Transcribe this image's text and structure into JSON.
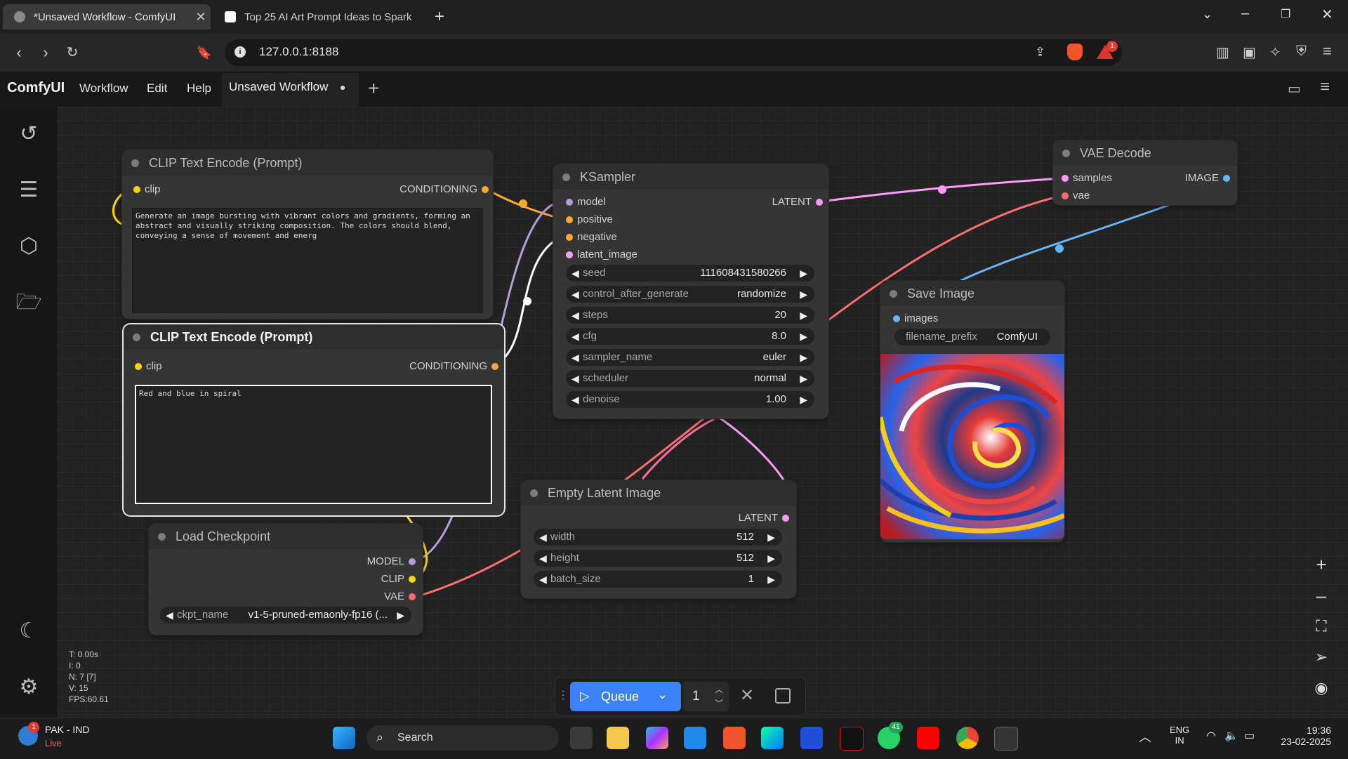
{
  "browser": {
    "tabs": [
      {
        "title": "*Unsaved Workflow - ComfyUI",
        "active": true
      },
      {
        "title": "Top 25 AI Art Prompt Ideas to Spark",
        "active": false
      }
    ],
    "url": "127.0.0.1:8188",
    "notification_count": "1"
  },
  "app": {
    "logo": "ComfyUI",
    "menu": [
      "Workflow",
      "Edit",
      "Help"
    ],
    "workflow_tab": "Unsaved Workflow",
    "unsaved_marker": "●"
  },
  "sidebar_icons": [
    "history-icon",
    "document-icon",
    "cube-icon",
    "folder-icon",
    "moon-icon",
    "gear-icon"
  ],
  "nodes": {
    "clip1": {
      "title": "CLIP Text Encode (Prompt)",
      "input": "clip",
      "output": "CONDITIONING",
      "text": "Generate an image bursting with vibrant colors and gradients, forming an abstract and visually striking composition. The colors should blend, conveying a sense of movement and energ"
    },
    "clip2": {
      "title": "CLIP Text Encode (Prompt)",
      "input": "clip",
      "output": "CONDITIONING",
      "text": "Red and blue in spiral"
    },
    "ksampler": {
      "title": "KSampler",
      "inputs": [
        "model",
        "positive",
        "negative",
        "latent_image"
      ],
      "output": "LATENT",
      "widgets": [
        {
          "label": "seed",
          "value": "111608431580266"
        },
        {
          "label": "control_after_generate",
          "value": "randomize"
        },
        {
          "label": "steps",
          "value": "20"
        },
        {
          "label": "cfg",
          "value": "8.0"
        },
        {
          "label": "sampler_name",
          "value": "euler"
        },
        {
          "label": "scheduler",
          "value": "normal"
        },
        {
          "label": "denoise",
          "value": "1.00"
        }
      ]
    },
    "vae": {
      "title": "VAE Decode",
      "inputs": [
        "samples",
        "vae"
      ],
      "output": "IMAGE"
    },
    "save": {
      "title": "Save Image",
      "input": "images",
      "widget_label": "filename_prefix",
      "widget_value": "ComfyUI"
    },
    "latent": {
      "title": "Empty Latent Image",
      "output": "LATENT",
      "widgets": [
        {
          "label": "width",
          "value": "512"
        },
        {
          "label": "height",
          "value": "512"
        },
        {
          "label": "batch_size",
          "value": "1"
        }
      ]
    },
    "ckpt": {
      "title": "Load Checkpoint",
      "outputs": [
        "MODEL",
        "CLIP",
        "VAE"
      ],
      "widget_label": "ckpt_name",
      "widget_value": "v1-5-pruned-emaonly-fp16 (..."
    }
  },
  "stats": {
    "t": "T: 0.00s",
    "i": "I: 0",
    "n": "N: 7 [7]",
    "v": "V: 15",
    "fps": "FPS:60.61"
  },
  "queue": {
    "label": "Queue",
    "count": "1"
  },
  "colors": {
    "latent": "#ff9cf9",
    "conditioning": "#ffa931",
    "clip": "#ffd500",
    "model": "#b39ddb",
    "vae": "#ff6e6e",
    "image": "#64b5f6",
    "accent": "#3b82f6"
  },
  "taskbar": {
    "weather_title": "PAK - IND",
    "weather_sub": "Live",
    "weather_badge": "1",
    "search": "Search",
    "whatsapp_badge": "41",
    "lang": "ENG",
    "region": "IN",
    "time": "19:36",
    "date": "23-02-2025"
  }
}
